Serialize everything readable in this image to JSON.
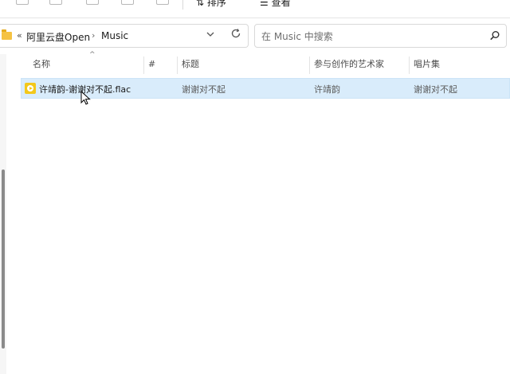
{
  "toolbar": {
    "sort_label": "排序",
    "view_label": "查看"
  },
  "address_bar": {
    "overflow": "«",
    "crumbs": [
      "阿里云盘Open",
      "Music"
    ],
    "separator": "›",
    "dropdown_icon": "chevron-down-icon",
    "refresh_icon": "refresh-icon"
  },
  "search": {
    "placeholder": "在 Music 中搜索",
    "value": "",
    "icon": "search-icon"
  },
  "columns": {
    "name": "名称",
    "number": "#",
    "title": "标题",
    "artist": "参与创作的艺术家",
    "album": "唱片集"
  },
  "files": [
    {
      "name": "许靖韵-谢谢对不起.flac",
      "number": "",
      "title": "谢谢对不起",
      "artist": "许靖韵",
      "album": "谢谢对不起",
      "icon": "audio-file-icon"
    }
  ],
  "colors": {
    "selection": "#d9ecfb",
    "file_icon": "#f3c81b",
    "folder_icon": "#f5c242"
  }
}
